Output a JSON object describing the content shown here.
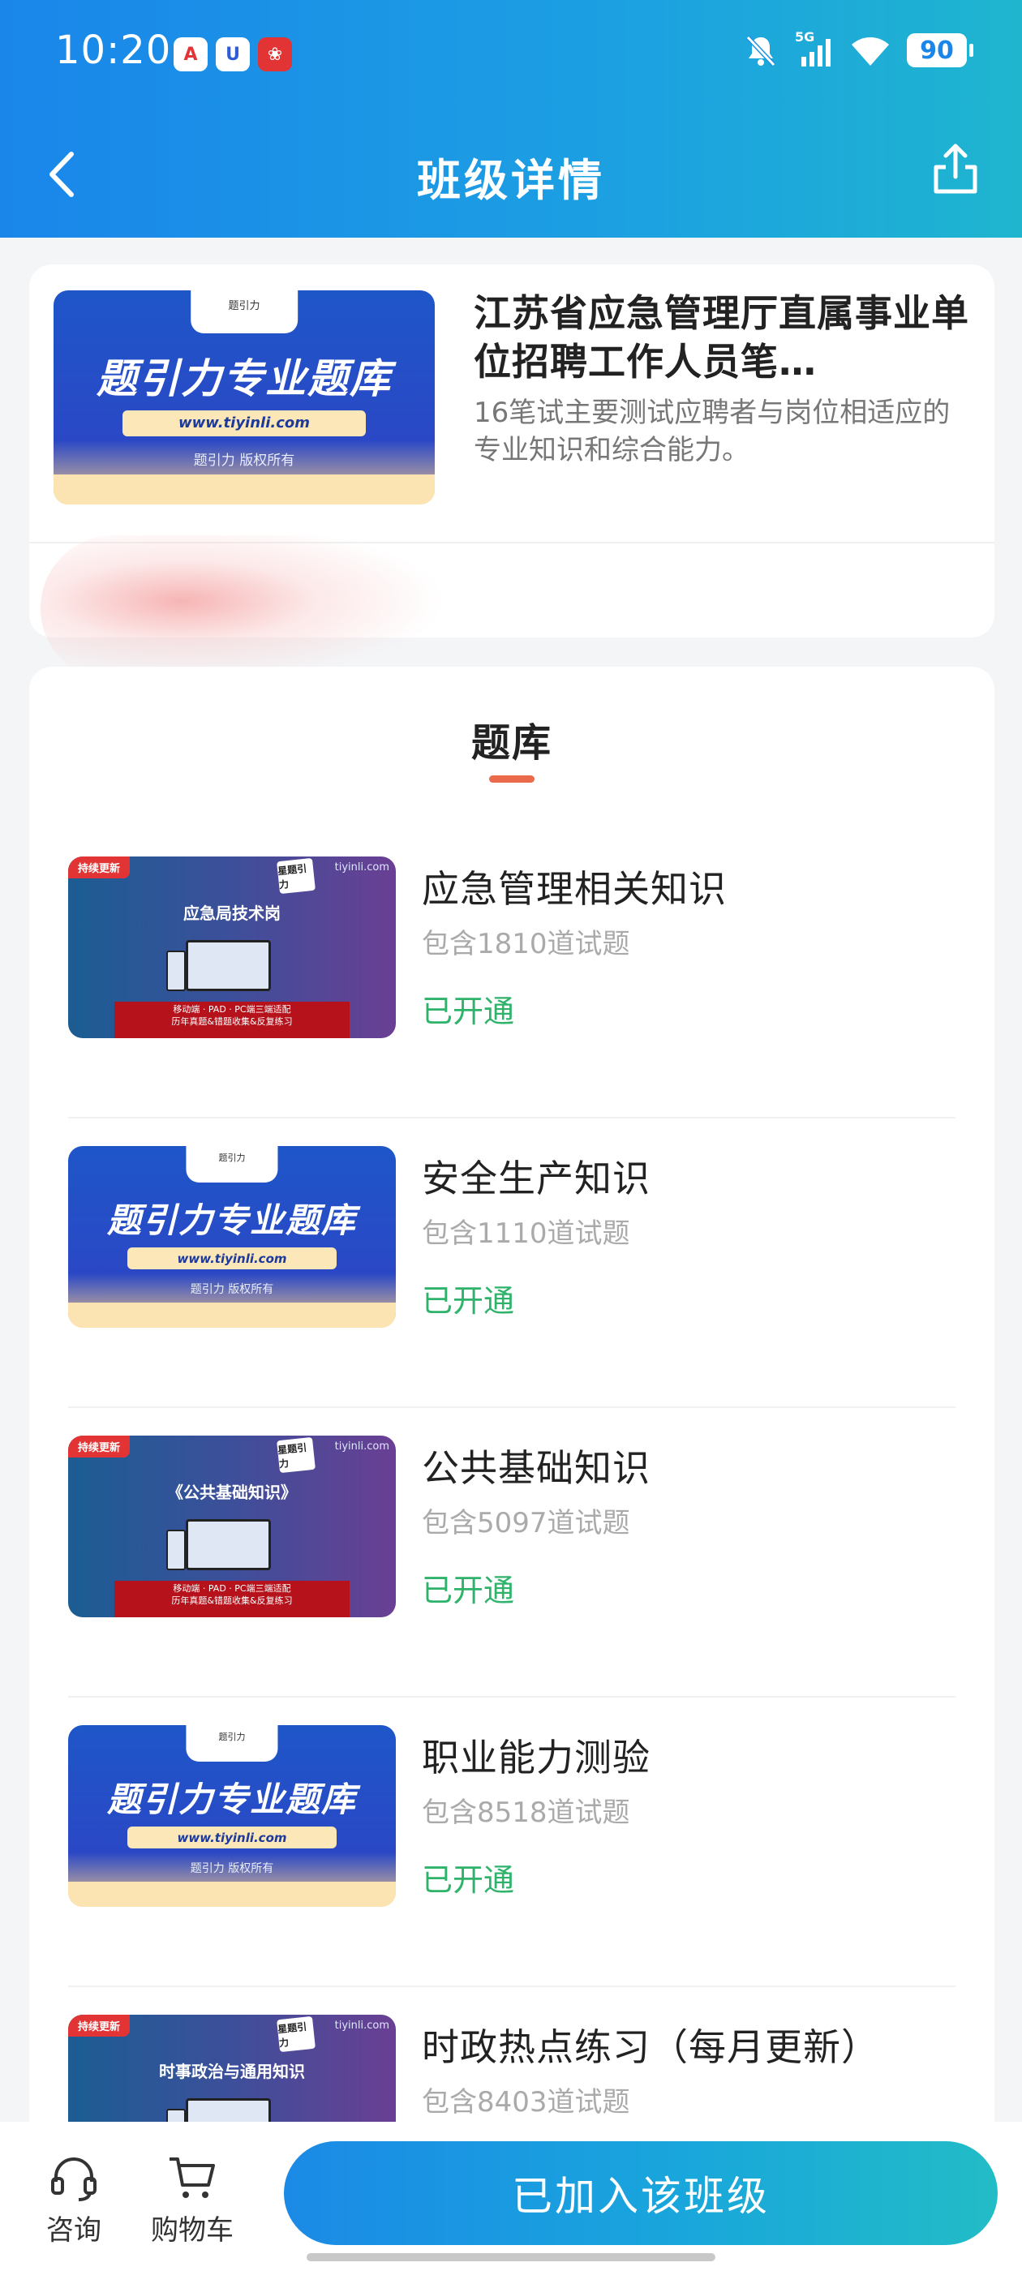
{
  "status_bar": {
    "time": "10:20",
    "network": "5G",
    "battery": "90"
  },
  "nav": {
    "title": "班级详情",
    "back_icon": "chevron-left-icon",
    "share_icon": "share-icon"
  },
  "class_card": {
    "title": "江苏省应急管理厅直属事业单位招聘工作人员笔…",
    "description": "16笔试主要测试应聘者与岗位相适应的专业知识和综合能力。",
    "cover": {
      "headline": "题引力专业题库",
      "url": "www.tiyinli.com",
      "copyright": "题引力 版权所有",
      "tab": "题引力"
    }
  },
  "section": {
    "title": "题库"
  },
  "covers": {
    "blue": {
      "headline": "题引力专业题库",
      "url": "www.tiyinli.com",
      "copyright": "题引力 版权所有",
      "tab": "题引力"
    },
    "purple": {
      "badge": "持续更新",
      "logo": "星题引力",
      "site": "tiyinli.com",
      "bar_line1": "移动端 · PAD · PC端三端适配",
      "bar_line2": "历年真题&错题收集&反复练习"
    }
  },
  "banks": [
    {
      "title": "应急管理相关知识",
      "count": "包含1810道试题",
      "status": "已开通",
      "cover": "purple",
      "cover_title": "应急局技术岗"
    },
    {
      "title": "安全生产知识",
      "count": "包含1110道试题",
      "status": "已开通",
      "cover": "blue"
    },
    {
      "title": "公共基础知识",
      "count": "包含5097道试题",
      "status": "已开通",
      "cover": "purple",
      "cover_title": "《公共基础知识》"
    },
    {
      "title": "职业能力测验",
      "count": "包含8518道试题",
      "status": "已开通",
      "cover": "blue"
    },
    {
      "title": "时政热点练习（每月更新）",
      "count": "包含8403道试题",
      "status": "",
      "cover": "purple",
      "cover_title": "时事政治与通用知识"
    }
  ],
  "bottom_bar": {
    "consult_label": "咨询",
    "cart_label": "购物车",
    "join_label": "已加入该班级"
  },
  "colors": {
    "header_start": "#1a86ea",
    "header_end": "#1fb5cf",
    "status_green": "#2fb36b",
    "accent_underline": "#ea6a4b"
  }
}
